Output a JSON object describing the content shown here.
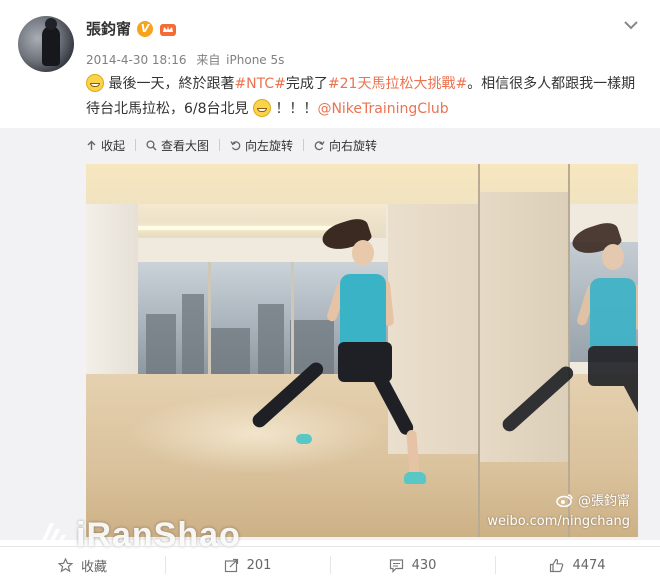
{
  "post": {
    "username": "張鈞甯",
    "verified_badge": "V",
    "timestamp": "2014-4-30 18:16",
    "source_prefix": "来自",
    "source_device": "iPhone 5s",
    "text_part1": "最後一天，終於跟著",
    "hashtag1": "#NTC#",
    "text_part2": "完成了",
    "hashtag2": "#21天馬拉松大挑戰#",
    "text_part3": "。相信很多人都跟我一樣期待台北馬拉松，6/8台北見",
    "text_part4": "！！！",
    "mention": "@NikeTrainingClub"
  },
  "media_toolbar": {
    "collapse": "收起",
    "view_large": "查看大图",
    "rotate_left": "向左旋转",
    "rotate_right": "向右旋转"
  },
  "photo": {
    "watermark_name": "@張鈞甯",
    "watermark_url": "weibo.com/ningchang"
  },
  "overlay": {
    "site_watermark": "iRanShao"
  },
  "actions": {
    "favorite": "收藏",
    "repost_count": "201",
    "comment_count": "430",
    "like_count": "4474"
  },
  "colors": {
    "link": "#eb7350",
    "verified": "#f7a31c",
    "media_bg": "#f2f2f5"
  }
}
